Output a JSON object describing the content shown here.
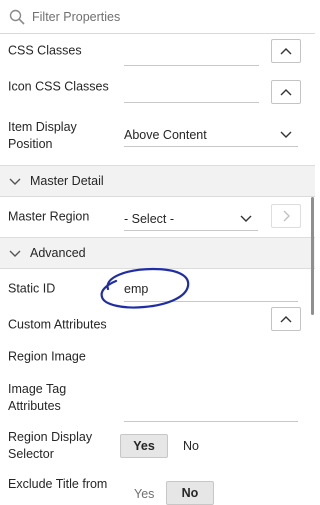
{
  "filter": {
    "placeholder": "Filter Properties"
  },
  "rows": {
    "css_classes": {
      "label": "CSS Classes"
    },
    "icon_css_classes": {
      "label": "Icon CSS Classes"
    },
    "item_display_position": {
      "label": "Item Display Position",
      "value": "Above Content"
    },
    "master_region": {
      "label": "Master Region",
      "value": "- Select -"
    },
    "static_id": {
      "label": "Static ID",
      "value": "emp"
    },
    "custom_attributes": {
      "label": "Custom Attributes"
    },
    "region_image": {
      "label": "Region Image"
    },
    "image_tag_attributes": {
      "label": "Image Tag Attributes"
    },
    "region_display_selector": {
      "label": "Region Display Selector",
      "yes": "Yes",
      "no": "No",
      "selected": "Yes"
    },
    "exclude_title": {
      "label": "Exclude Title from",
      "yes": "Yes",
      "no": "No",
      "selected": "No"
    }
  },
  "sections": {
    "master_detail": "Master Detail",
    "advanced": "Advanced"
  },
  "icons": {
    "filter": "search-icon",
    "expand": "chevron-up-icon",
    "collapse": "chevron-down-icon",
    "go": "chevron-right-icon"
  },
  "colors": {
    "annotation": "#1f2ea8",
    "section_bg": "#f2f2f2"
  }
}
